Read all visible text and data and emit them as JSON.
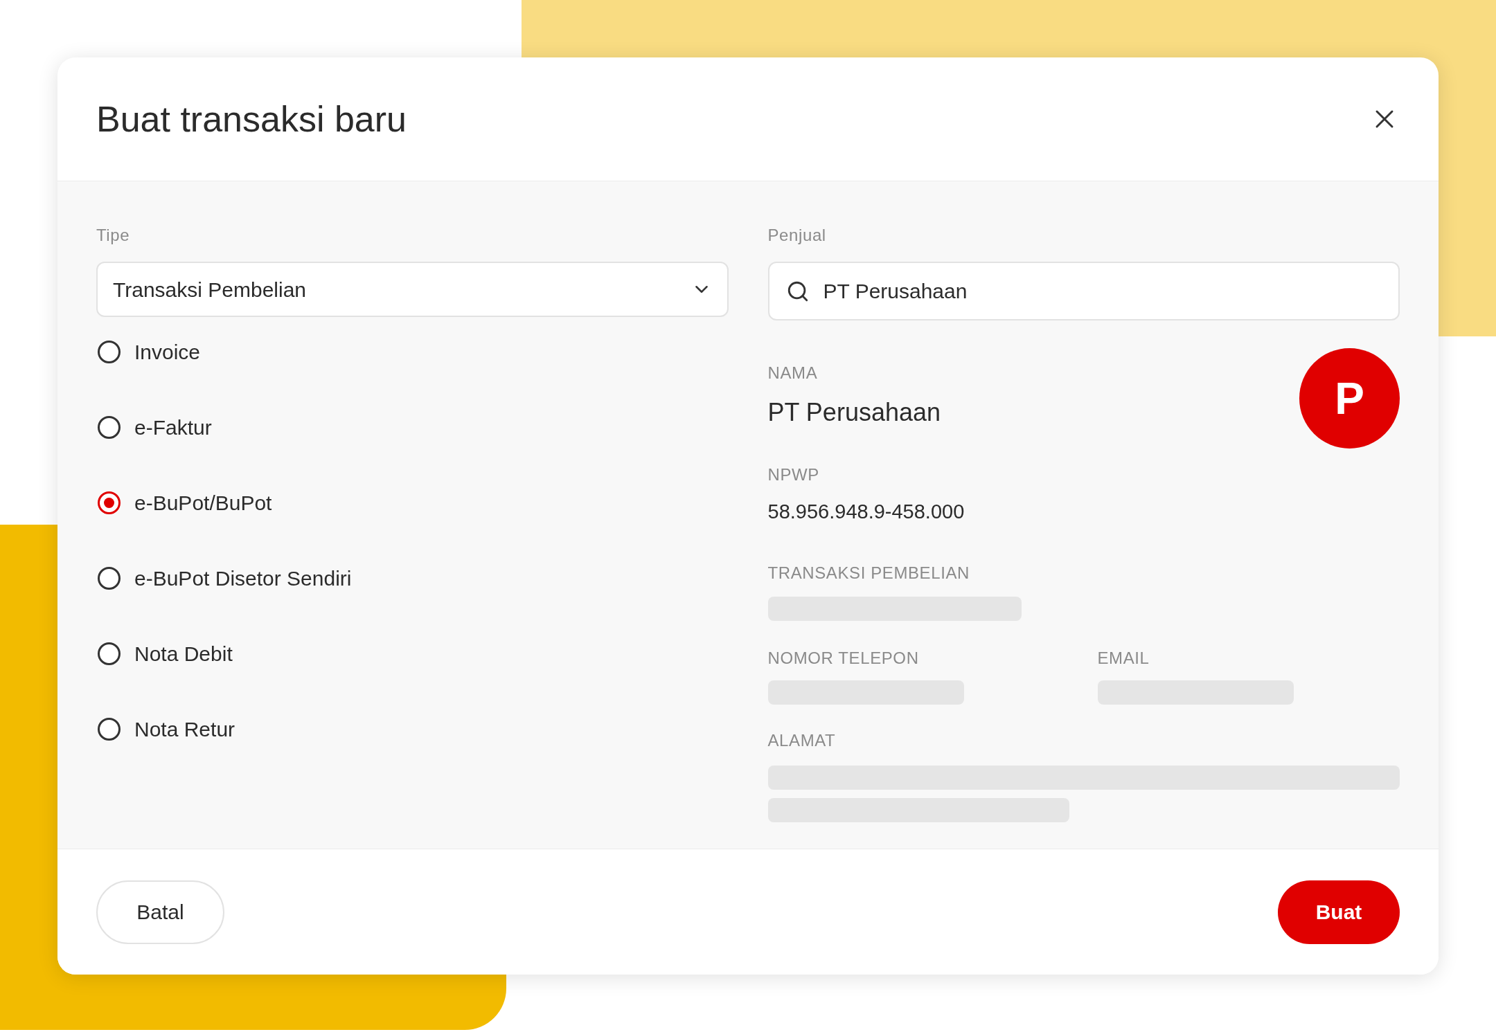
{
  "dialog": {
    "title": "Buat transaksi baru"
  },
  "type_field": {
    "label": "Tipe",
    "value": "Transaksi Pembelian"
  },
  "options": [
    {
      "label": "Invoice",
      "selected": false
    },
    {
      "label": "e-Faktur",
      "selected": false
    },
    {
      "label": "e-BuPot/BuPot",
      "selected": true
    },
    {
      "label": "e-BuPot Disetor Sendiri",
      "selected": false
    },
    {
      "label": "Nota Debit",
      "selected": false
    },
    {
      "label": "Nota Retur",
      "selected": false
    }
  ],
  "seller": {
    "label": "Penjual",
    "value": "PT Perusahaan"
  },
  "details": {
    "name_label": "NAMA",
    "name": "PT Perusahaan",
    "avatar": "P",
    "npwp_label": "NPWP",
    "npwp": "58.956.948.9-458.000",
    "transaction_label": "TRANSAKSI PEMBELIAN",
    "phone_label": "NOMOR TELEPON",
    "email_label": "EMAIL",
    "address_label": "ALAMAT"
  },
  "buttons": {
    "cancel": "Batal",
    "create": "Buat"
  }
}
